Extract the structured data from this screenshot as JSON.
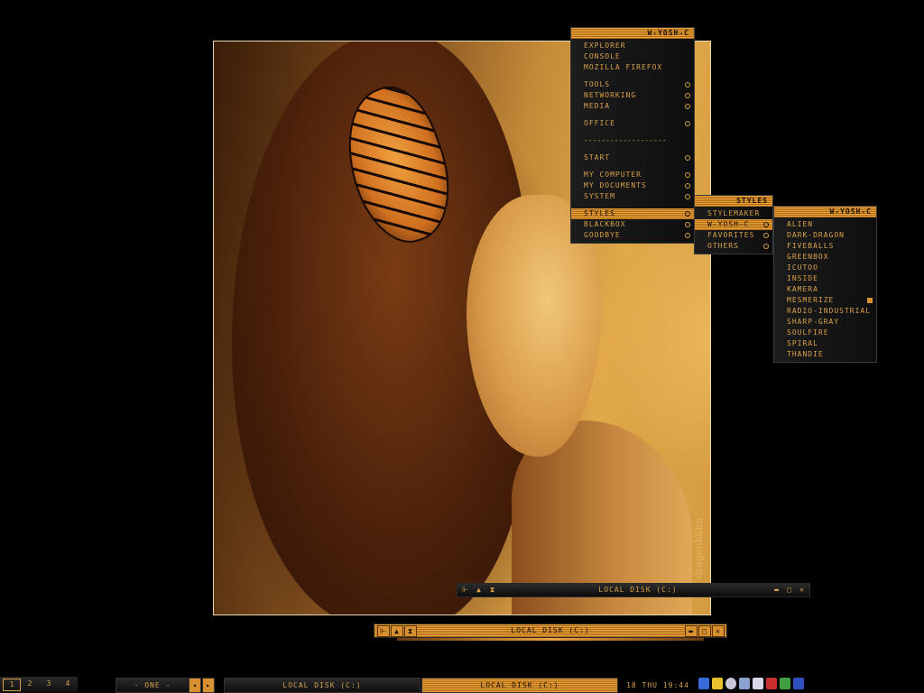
{
  "wallpaper": {
    "signature": "dragonkahn"
  },
  "main_menu": {
    "title": "W-YOSH-C",
    "items": [
      {
        "label": "EXPLORER",
        "submenu": false
      },
      {
        "label": "CONSOLE",
        "submenu": false
      },
      {
        "label": "MOZILLA FIREFOX",
        "submenu": false
      },
      {
        "label": "TOOLS",
        "submenu": true
      },
      {
        "label": "NETWORKING",
        "submenu": true
      },
      {
        "label": "MEDIA",
        "submenu": true
      },
      {
        "label": "OFFICE",
        "submenu": true
      },
      {
        "label": "-------------------",
        "separator": true
      },
      {
        "label": "START",
        "submenu": true
      },
      {
        "label": "MY COMPUTER",
        "submenu": true
      },
      {
        "label": "MY DOCUMENTS",
        "submenu": true
      },
      {
        "label": "SYSTEM",
        "submenu": true
      },
      {
        "label": "STYLES",
        "submenu": true,
        "active": true
      },
      {
        "label": "BLACKBOX",
        "submenu": true
      },
      {
        "label": "GOODBYE",
        "submenu": true
      }
    ]
  },
  "styles_menu": {
    "title": "STYLES",
    "items": [
      {
        "label": "STYLEMAKER",
        "submenu": false
      },
      {
        "label": "W-YOSH-C",
        "submenu": true,
        "active": true
      },
      {
        "label": "FAVORITES",
        "submenu": true
      },
      {
        "label": "OTHERS",
        "submenu": true
      }
    ]
  },
  "theme_menu": {
    "title": "W-YOSH-C",
    "items": [
      {
        "label": "ALIEN"
      },
      {
        "label": "DARK-DRAGON"
      },
      {
        "label": "FIVEBALLS"
      },
      {
        "label": "GREENBOX"
      },
      {
        "label": "ICUTOO"
      },
      {
        "label": "INSIDE"
      },
      {
        "label": "KAMERA"
      },
      {
        "label": "MESMERIZE",
        "selected": true
      },
      {
        "label": "RADIO-INDUSTRIAL"
      },
      {
        "label": "SHARP-GRAY"
      },
      {
        "label": "SOULFIRE"
      },
      {
        "label": "SPIRAL"
      },
      {
        "label": "THANDIE"
      }
    ]
  },
  "window_upper": {
    "title": "LOCAL DISK (C:)"
  },
  "window_lower": {
    "title": "LOCAL DISK (C:)"
  },
  "taskbar": {
    "workspaces": [
      "1",
      "2",
      "3",
      "4"
    ],
    "current_workspace": "1",
    "workspace_name": "- ONE -",
    "tasks": [
      {
        "label": "LOCAL DISK (C:)",
        "active": false
      },
      {
        "label": "LOCAL DISK (C:)",
        "active": true
      }
    ],
    "clock": "18 THU 19:44"
  },
  "colors": {
    "accent": "#e8a43c",
    "accent_dark": "#b06a14",
    "text": "#d8a04a",
    "bg": "#000000"
  }
}
